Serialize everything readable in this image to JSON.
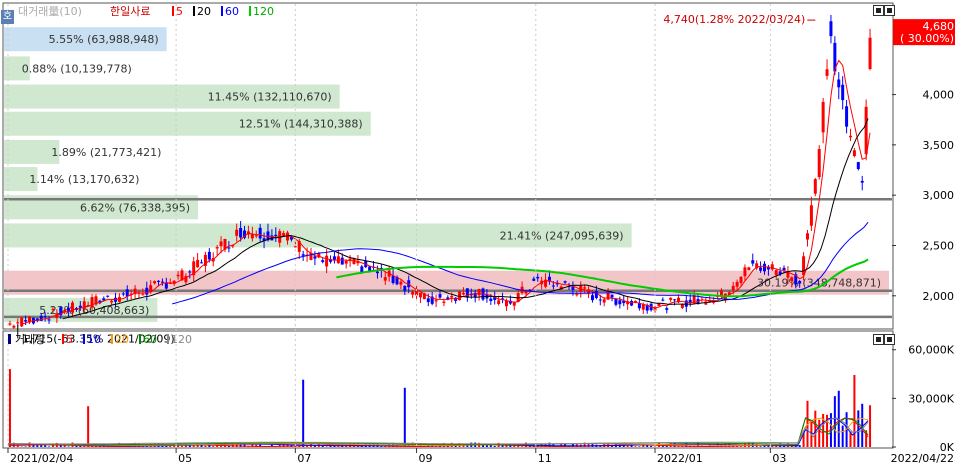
{
  "chart_data": [
    {
      "type": "candlestick",
      "legend": {
        "prefix": "대거래量(10)",
        "symbol": "한일사료",
        "items": [
          {
            "label": "5",
            "color": "#ff0000"
          },
          {
            "label": "20",
            "color": "#000000"
          },
          {
            "label": "60",
            "color": "#0000ff"
          },
          {
            "label": "120",
            "color": "#00cc00"
          }
        ]
      },
      "corner_label": "호",
      "y_ticks": [
        "4,000",
        "3,500",
        "3,000",
        "2,500",
        "2,000"
      ],
      "y_tick_values": [
        4000,
        3500,
        3000,
        2500,
        2000
      ],
      "ylim": [
        1680,
        4900
      ],
      "current_price": "4,680",
      "current_change": "( 30.00%)",
      "high_annotation": "4,740(1.28% 2022/03/24)",
      "low_annotation": "1,715(-63.35% 2021/02/09)",
      "horizontal_lines": [
        2960,
        2050,
        1790
      ],
      "volume_profile": [
        {
          "label": "5.55% (63,988,948)",
          "price": 4550
        },
        {
          "label": "0.88% (10,139,778)",
          "price": 4260
        },
        {
          "label": "11.45% (132,110,670)",
          "price": 3980
        },
        {
          "label": "12.51% (144,310,388)",
          "price": 3710
        },
        {
          "label": "1.89% (21,773,421)",
          "price": 3430
        },
        {
          "label": "1.14% (13,170,632)",
          "price": 3160
        },
        {
          "label": "6.62% (76,338,395)",
          "price": 2880
        },
        {
          "label": "21.41% (247,095,639)",
          "price": 2600
        },
        {
          "label": "30.19% (348,748,871)",
          "price": 2130
        },
        {
          "label": "5.23% (60,408,663)",
          "price": 1860
        }
      ],
      "ma_series": [
        {
          "name": "5",
          "color": "#ff0000"
        },
        {
          "name": "20",
          "color": "#000000"
        },
        {
          "name": "60",
          "color": "#0000ff"
        },
        {
          "name": "120",
          "color": "#00cc00"
        }
      ]
    },
    {
      "type": "bar",
      "title": "거래량",
      "legend": [
        {
          "label": "5",
          "color": "#ff0000"
        },
        {
          "label": "10",
          "color": "#0000ff"
        },
        {
          "label": "20",
          "color": "#ff9900"
        },
        {
          "label": "60",
          "color": "#008800"
        },
        {
          "label": "120",
          "color": "#888888"
        }
      ],
      "y_ticks": [
        "60,000K",
        "30,000K",
        "0K"
      ],
      "y_tick_values": [
        60000,
        30000,
        0
      ],
      "ylim": [
        0,
        66000
      ]
    }
  ],
  "x_axis": {
    "labels": [
      {
        "text": "2021/02/04",
        "date": "2021/02/04"
      },
      {
        "text": "05",
        "date": "2021/05"
      },
      {
        "text": "07",
        "date": "2021/07"
      },
      {
        "text": "09",
        "date": "2021/09"
      },
      {
        "text": "11",
        "date": "2021/11"
      },
      {
        "text": "2022/01",
        "date": "2022/01"
      },
      {
        "text": "03",
        "date": "2022/03"
      }
    ],
    "end_label": "2022/04/22"
  }
}
